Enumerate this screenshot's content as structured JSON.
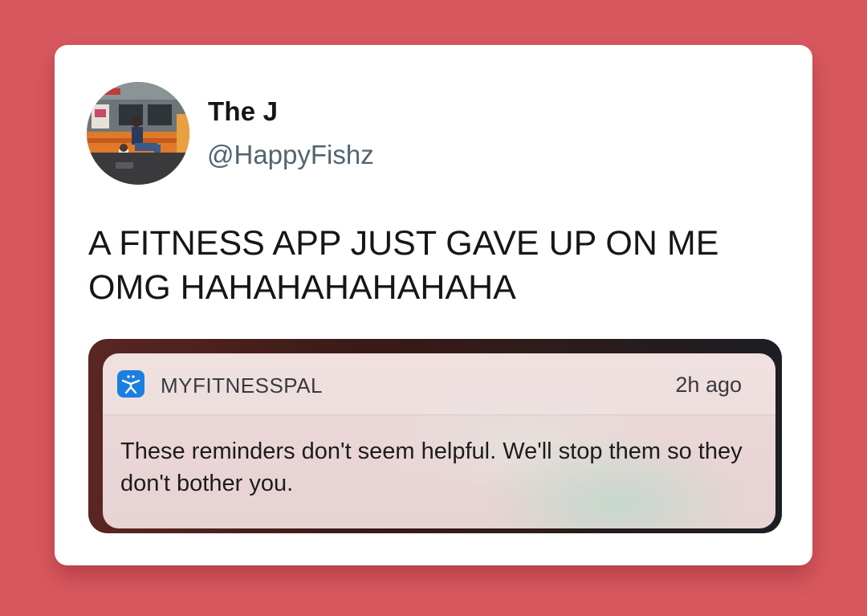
{
  "tweet": {
    "display_name": "The J",
    "handle": "@HappyFishz",
    "text": "A FITNESS APP JUST GAVE UP ON ME OMG HAHAHAHAHAHAHA",
    "avatar_icon": "avatar-photo-icon"
  },
  "notification": {
    "app_icon": "myfitnesspal-icon",
    "app_name": "MYFITNESSPAL",
    "time": "2h ago",
    "body": "These reminders don't seem helpful. We'll stop them so they don't bother you."
  },
  "colors": {
    "background": "#d8585f",
    "card": "#ffffff",
    "app_icon": "#1a7fe0"
  }
}
